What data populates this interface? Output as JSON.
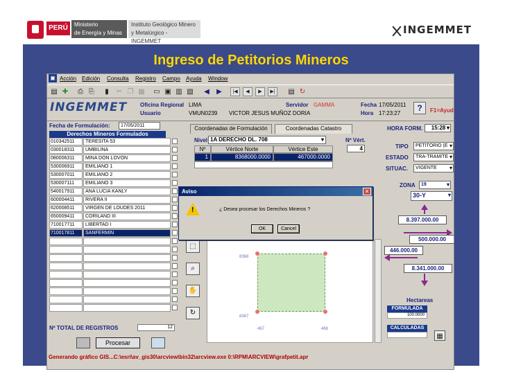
{
  "slide": {
    "header": {
      "peru": "PERÚ",
      "ministry_line1": "Ministerio",
      "ministry_line2": "de Energía y Minas",
      "institute_line1": "Instituto Geológico Minero",
      "institute_line2": "y Metalúrgico - INGEMMET",
      "logo": "INGEMMET"
    },
    "title": "Ingreso de Petitorios Mineros"
  },
  "menu": [
    "Acción",
    "Edición",
    "Consulta",
    "Registro",
    "Campo",
    "Ayuda",
    "Window"
  ],
  "info": {
    "oficina_label": "Oficina Regional",
    "oficina_value": "LIMA",
    "usuario_label": "Usuario",
    "usuario_code": "VMUN0239",
    "usuario_name": "VICTOR JESUS MUÑOZ DORIA",
    "servidor_label": "Servidor",
    "servidor_value": "GAMMA",
    "fecha_label": "Fecha",
    "fecha_value": "17/05/2011",
    "hora_label": "Hora",
    "hora_value": "17:23:27",
    "help_label": "F1=Ayuda",
    "help_icon": "?"
  },
  "left": {
    "fecha_label": "Fecha de Formulación:",
    "fecha_value": "17/05/2011",
    "list_header": "Derechos Mineros Formulados",
    "rows": [
      {
        "code": "010342511",
        "name": "TERESITA 53"
      },
      {
        "code": "030018311",
        "name": "UMBILINA"
      },
      {
        "code": "080006311",
        "name": "MINA DON LOVON"
      },
      {
        "code": "530006911",
        "name": "EMILIANO 1"
      },
      {
        "code": "530007011",
        "name": "EMILIANO 2"
      },
      {
        "code": "530007111",
        "name": "EMILIANO 3"
      },
      {
        "code": "540017911",
        "name": "ANA LUCIA KANLY"
      },
      {
        "code": "600004411",
        "name": "RIVERA II"
      },
      {
        "code": "620008511",
        "name": "VIRGEN DE LOUDES 2011"
      },
      {
        "code": "650009411",
        "name": "CORILAND III"
      },
      {
        "code": "710017711",
        "name": "LIBERTAD I"
      },
      {
        "code": "710017811",
        "name": "SANFERMIN"
      },
      {
        "code": "",
        "name": ""
      },
      {
        "code": "",
        "name": ""
      },
      {
        "code": "",
        "name": ""
      },
      {
        "code": "",
        "name": ""
      },
      {
        "code": "",
        "name": ""
      },
      {
        "code": "",
        "name": ""
      },
      {
        "code": "",
        "name": ""
      },
      {
        "code": "",
        "name": ""
      },
      {
        "code": "",
        "name": ""
      }
    ],
    "selected_index": 11,
    "total_label": "Nº TOTAL DE REGISTROS",
    "total_value": "12",
    "process_button": "Procesar"
  },
  "tabs": [
    "Coordenadas de Formulación",
    "Coordenadas Catastro"
  ],
  "coords": {
    "nivel_label": "Nivel",
    "nivel_value": "1A DERECHO DL. 708",
    "nvert_label": "Nº Vért.",
    "nvert_value": "4",
    "headers": [
      "Nº",
      "Vértice Norte",
      "Vértice Este"
    ],
    "row1": {
      "n": "1",
      "norte": "8368000.0000",
      "este": "467000.0000"
    }
  },
  "map": {
    "y_top": "8368",
    "y_bottom": "8367",
    "x_left": "467",
    "x_right": "468"
  },
  "right": {
    "hora_form_label": "HORA FORM.",
    "hora_form_value": "15:28",
    "tipo_label": "TIPO",
    "tipo_value": "PETITORIO (E",
    "estado_label": "ESTADO",
    "estado_value": "TRA-TRAMITE",
    "situac_label": "SITUAC.",
    "situac_value": "VIGENTE",
    "zona_label": "ZONA",
    "zona_value": "19",
    "datum_value": "30-Y",
    "north": "8.397.000.00",
    "east": "500.000.00",
    "west": "446.000.00",
    "south": "8.341.000.00",
    "hectareas_label": "Hectareas",
    "formulada_label": "FORMULADA",
    "formulada_value": "100.0000",
    "calculadas_label": "CALCULADAS"
  },
  "status": "Generando gráfico GIS...C:\\esri\\av_gis30\\arcview\\bin32\\arcview.exe 0:\\RPM\\ARCVIEW\\grafpetit.apr",
  "dialog": {
    "title": "Aviso",
    "message": "¿ Desea procesar los Derechos Mineros ?",
    "ok": "OK",
    "cancel": "Cancel"
  },
  "colors": {
    "slide_bg": "#3a4a8a",
    "title": "#ffd700",
    "window": "#d4d0c8",
    "selection": "#0a246a",
    "accent_label": "#1a237e",
    "status_text": "#b00000",
    "arrow": "#8a2a8a"
  }
}
